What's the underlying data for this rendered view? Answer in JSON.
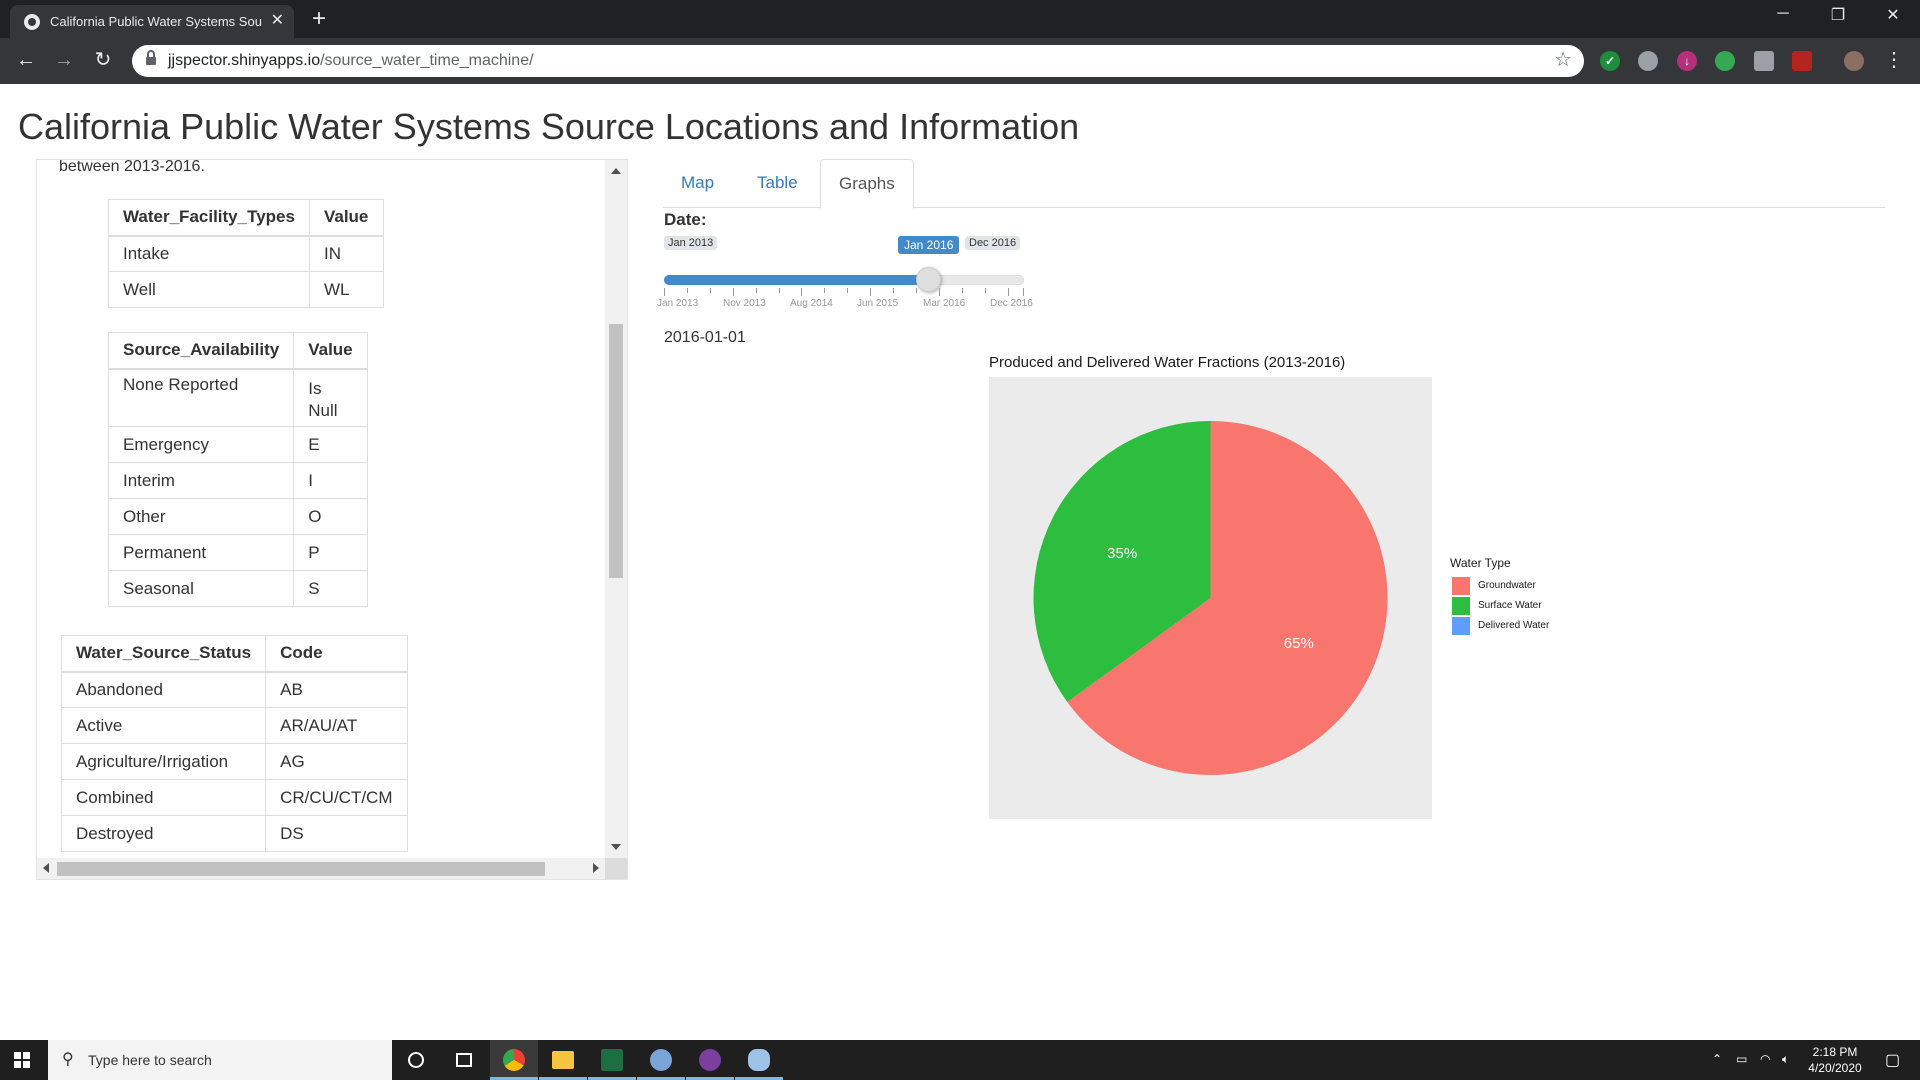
{
  "browser": {
    "tab_title": "California Public Water Systems Source",
    "url_host": "jjspector.shinyapps.io",
    "url_path": "/source_water_time_machine/"
  },
  "page": {
    "title": "California Public Water Systems Source Locations and Information"
  },
  "sidebar": {
    "intro_text": "between 2013-2016.",
    "facility_table": {
      "headers": [
        "Water_Facility_Types",
        "Value"
      ],
      "rows": [
        [
          "Intake",
          "IN"
        ],
        [
          "Well",
          "WL"
        ]
      ]
    },
    "availability_table": {
      "headers": [
        "Source_Availability",
        "Value"
      ],
      "rows": [
        [
          "None Reported",
          "Is Null"
        ],
        [
          "Emergency",
          "E"
        ],
        [
          "Interim",
          "I"
        ],
        [
          "Other",
          "O"
        ],
        [
          "Permanent",
          "P"
        ],
        [
          "Seasonal",
          "S"
        ]
      ]
    },
    "status_table": {
      "headers": [
        "Water_Source_Status",
        "Code"
      ],
      "rows": [
        [
          "Abandoned",
          "AB"
        ],
        [
          "Active",
          "AR/AU/AT"
        ],
        [
          "Agriculture/Irrigation",
          "AG"
        ],
        [
          "Combined",
          "CR/CU/CT/CM"
        ],
        [
          "Destroyed",
          "DS"
        ]
      ]
    }
  },
  "main": {
    "tabs": [
      {
        "label": "Map",
        "active": false
      },
      {
        "label": "Table",
        "active": false
      },
      {
        "label": "Graphs",
        "active": true
      }
    ],
    "date_label": "Date:",
    "slider": {
      "min_label": "Jan 2013",
      "max_label": "Dec 2016",
      "value_label": "Jan 2016",
      "value_fraction": 0.7333,
      "tick_labels": [
        "Jan 2013",
        "Nov 2013",
        "Aug 2014",
        "Jun 2015",
        "Mar 2016",
        "Dec 2016"
      ]
    },
    "date_output": "2016-01-01"
  },
  "chart_data": {
    "type": "pie",
    "title": "Produced and Delivered Water Fractions (2013-2016)",
    "legend_title": "Water Type",
    "legend_position": "right",
    "slices": [
      {
        "name": "Groundwater",
        "value": 65,
        "label": "65%",
        "color": "#F8766D"
      },
      {
        "name": "Surface Water",
        "value": 35,
        "label": "35%",
        "color": "#2DBD3F"
      },
      {
        "name": "Delivered Water",
        "value": 0,
        "label": "",
        "color": "#619CFF"
      }
    ]
  },
  "taskbar": {
    "search_placeholder": "Type here to search",
    "time": "2:18 PM",
    "date": "4/20/2020"
  }
}
